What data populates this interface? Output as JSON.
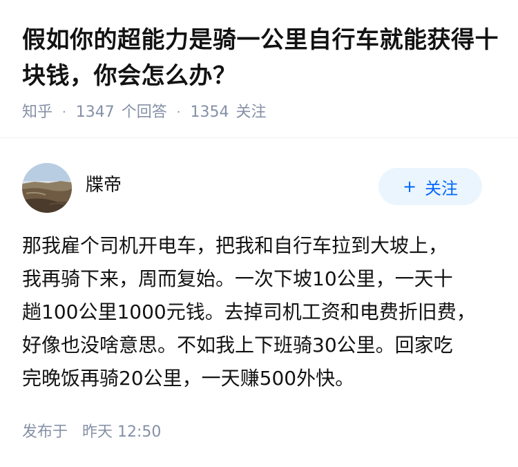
{
  "question": {
    "title": "假如你的超能力是骑一公里自行车就能获得十块钱，你会怎么办？",
    "source": "知乎",
    "answer_count": "1347",
    "answer_label": "个回答",
    "follower_count": "1354",
    "follower_label": "关注",
    "separator": "·"
  },
  "author": {
    "name": "牒帝",
    "follow_label": "关注",
    "follow_icon": "plus-icon",
    "avatar": "landscape-photo"
  },
  "answer": {
    "lines": [
      "那我雇个司机开电车，把我和自行车拉到大坡上，",
      "我再骑下来，周而复始。一次下坡10公里，一天十",
      "趟100公里1000元钱。去掉司机工资和电费折旧费，",
      "好像也没啥意思。不如我上下班骑30公里。回家吃",
      "完晚饭再骑20公里，一天赚500外快。"
    ]
  },
  "publish": {
    "label": "发布于",
    "time": "昨天 12:50"
  },
  "colors": {
    "accent": "#0066ff",
    "button_bg": "#ebf5fd",
    "meta_text": "#8590a6",
    "main_text": "#121212"
  }
}
